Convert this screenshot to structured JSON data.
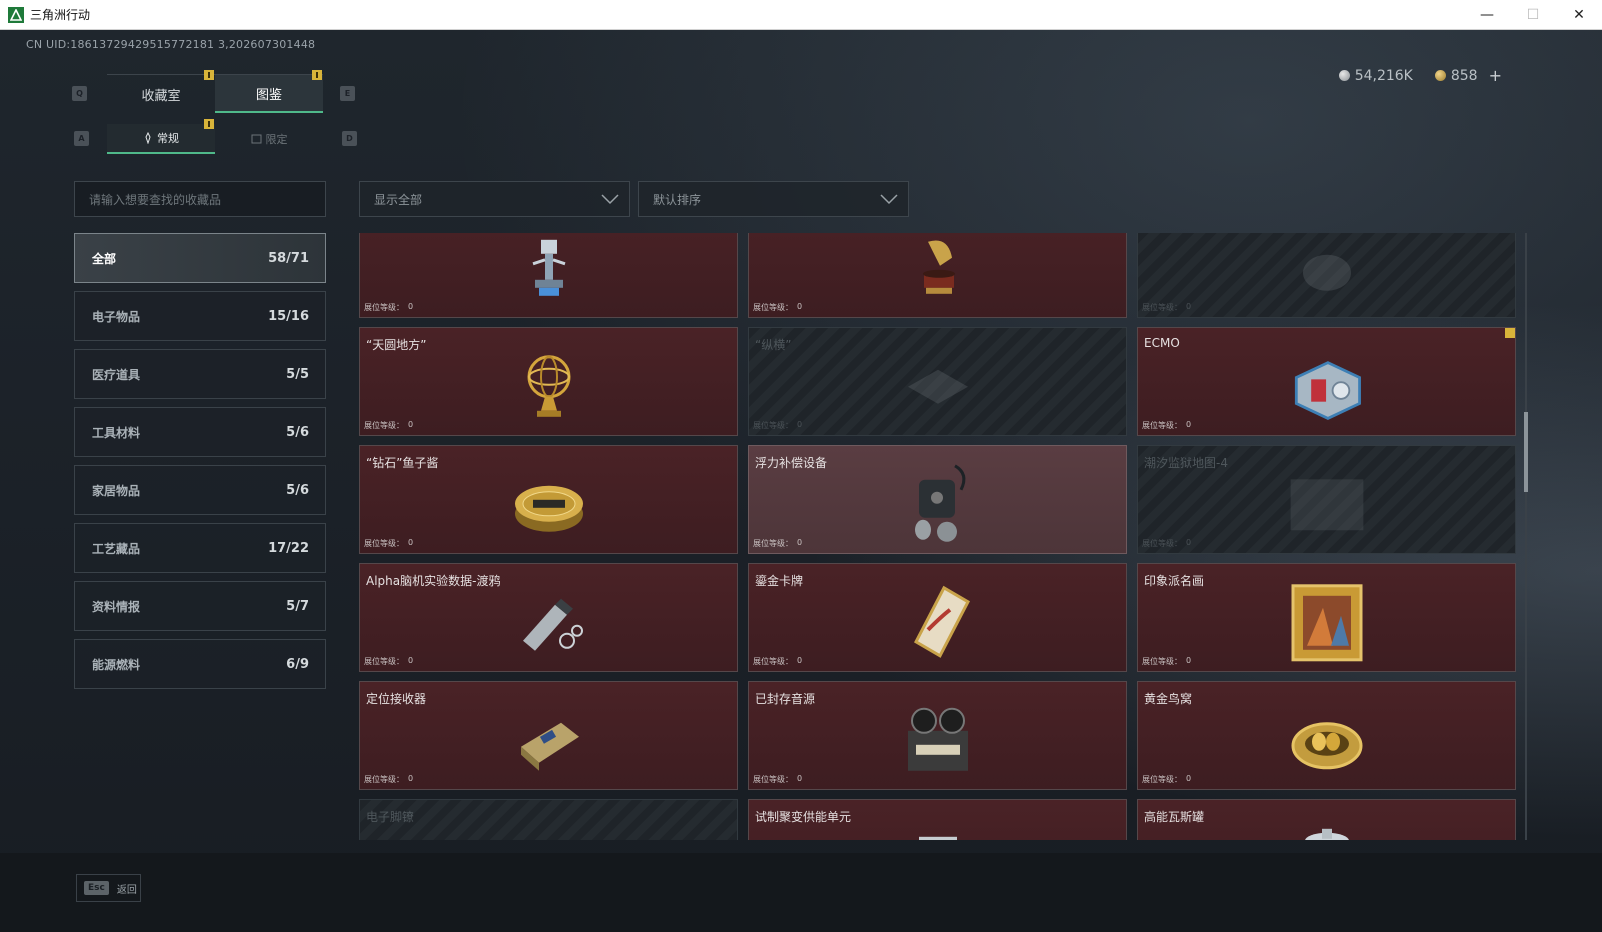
{
  "window": {
    "title": "三角洲行动",
    "minimize": "—",
    "maximize": "☐",
    "close": "✕"
  },
  "uid": "CN UID:18613729429515772181 3,202607301448",
  "currency": {
    "silver": "54,216K",
    "gold": "858",
    "plus": "+"
  },
  "tabs": {
    "left_key": "Q",
    "right_key": "E",
    "main": [
      {
        "label": "收藏室",
        "active": false
      },
      {
        "label": "图鉴",
        "active": true
      }
    ],
    "sub_left_key": "A",
    "sub_right_key": "D",
    "sub": [
      {
        "label": "常规",
        "active": true
      },
      {
        "label": "限定",
        "active": false
      }
    ]
  },
  "search": {
    "placeholder": "请输入想要查找的收藏品"
  },
  "filters": {
    "show": "显示全部",
    "sort": "默认排序"
  },
  "categories": [
    {
      "label": "全部",
      "count": "58/71",
      "active": true
    },
    {
      "label": "电子物品",
      "count": "15/16"
    },
    {
      "label": "医疗道具",
      "count": "5/5"
    },
    {
      "label": "工具材料",
      "count": "5/6"
    },
    {
      "label": "家居物品",
      "count": "5/6"
    },
    {
      "label": "工艺藏品",
      "count": "17/22"
    },
    {
      "label": "资料情报",
      "count": "5/7"
    },
    {
      "label": "能源燃料",
      "count": "6/9"
    }
  ],
  "level_label": "展位等级：",
  "items": [
    {
      "name": "",
      "level": "0",
      "state": "owned",
      "icon": "robot-icon"
    },
    {
      "name": "",
      "level": "0",
      "state": "owned",
      "icon": "gramophone-icon"
    },
    {
      "name": "",
      "level": "0",
      "state": "locked",
      "icon": "helmet-icon"
    },
    {
      "name": "“天圆地方”",
      "level": "0",
      "state": "owned",
      "icon": "armillary-sphere-icon"
    },
    {
      "name": "“纵横”",
      "level": "0",
      "state": "locked",
      "icon": "chessboard-icon"
    },
    {
      "name": "ECMO",
      "level": "0",
      "state": "owned",
      "icon": "ecmo-machine-icon",
      "flag": true
    },
    {
      "name": "“钻石”鱼子酱",
      "level": "0",
      "state": "owned",
      "icon": "caviar-tin-icon"
    },
    {
      "name": "浮力补偿设备",
      "level": "0",
      "state": "highlight",
      "icon": "diving-gear-icon"
    },
    {
      "name": "潮汐监狱地图-4",
      "level": "0",
      "state": "locked",
      "icon": "map-icon"
    },
    {
      "name": "Alpha脑机实验数据-渡鸦",
      "level": "0",
      "state": "owned",
      "icon": "data-drive-icon"
    },
    {
      "name": "鎏金卡牌",
      "level": "0",
      "state": "owned",
      "icon": "gilded-card-icon"
    },
    {
      "name": "印象派名画",
      "level": "0",
      "state": "owned",
      "icon": "painting-icon"
    },
    {
      "name": "定位接收器",
      "level": "0",
      "state": "owned",
      "icon": "receiver-icon"
    },
    {
      "name": "已封存音源",
      "level": "0",
      "state": "owned",
      "icon": "tape-recorder-icon"
    },
    {
      "name": "黄金鸟窝",
      "level": "0",
      "state": "owned",
      "icon": "golden-nest-icon"
    },
    {
      "name": "电子脚镣",
      "level": "",
      "state": "locked",
      "icon": "ankle-monitor-icon"
    },
    {
      "name": "试制聚变供能单元",
      "level": "",
      "state": "owned",
      "icon": "fusion-unit-icon"
    },
    {
      "name": "高能瓦斯罐",
      "level": "",
      "state": "owned",
      "icon": "gas-canister-icon"
    }
  ],
  "footer": {
    "esc_key": "Esc",
    "esc_label": "返回"
  },
  "colors": {
    "accent": "#4fb98a",
    "card_owned": "#4a2226",
    "marker": "#d8b43a"
  }
}
